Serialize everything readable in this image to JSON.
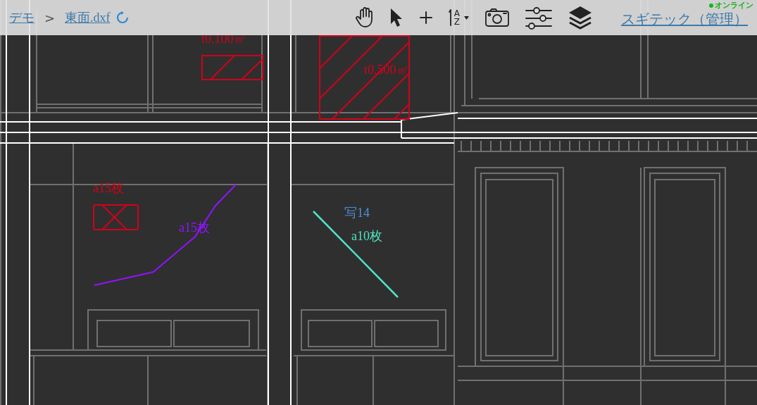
{
  "breadcrumb": [
    {
      "label": "デモ",
      "kind": "link"
    },
    {
      "label": ">",
      "kind": "separator"
    },
    {
      "label": "東面.dxf",
      "kind": "link"
    }
  ],
  "toolbar": [
    {
      "kind": "hand"
    },
    {
      "kind": "pointer"
    },
    {
      "kind": "plus"
    },
    {
      "kind": "sort",
      "top": "A",
      "bottom": "Z"
    },
    {
      "kind": "camera"
    },
    {
      "kind": "sliders"
    },
    {
      "kind": "layers"
    }
  ],
  "user": {
    "name": "スギテック（管理）",
    "status": "オンライン",
    "online": true
  },
  "markups": [
    {
      "label": "t0.100㎡",
      "kind": "hatch-rect",
      "color": "#d0021b"
    },
    {
      "label": "t0.500㎡",
      "kind": "hatch-square",
      "color": "#d0021b"
    },
    {
      "label": "a15枚",
      "kind": "cross",
      "color": "#d0021b"
    },
    {
      "label": "a15枚",
      "kind": "polyline",
      "color": "#9013fe"
    },
    {
      "label": "写14",
      "kind": "photo",
      "color": "#4a90d9"
    },
    {
      "label": "a10枚",
      "kind": "line",
      "color": "#50e3c2"
    }
  ]
}
